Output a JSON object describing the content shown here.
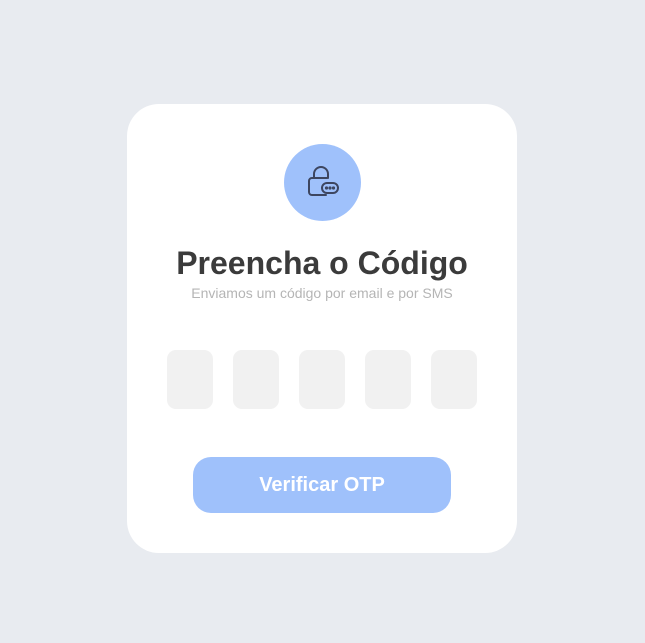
{
  "card": {
    "icon": "lock-message-icon",
    "title": "Preencha o Código",
    "subtitle": "Enviamos um código por email e por SMS"
  },
  "otp": {
    "digits": [
      "",
      "",
      "",
      "",
      ""
    ]
  },
  "actions": {
    "verify_label": "Verificar OTP"
  },
  "colors": {
    "background": "#e8ebf0",
    "card": "#ffffff",
    "accent": "#9fc1fb",
    "title": "#3b3b3b",
    "subtitle": "#b5b5b5",
    "otp_box": "#f1f1f1",
    "icon_stroke": "#3d4660"
  }
}
